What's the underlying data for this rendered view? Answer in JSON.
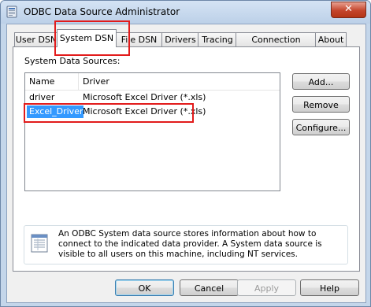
{
  "window": {
    "title": "ODBC Data Source Administrator",
    "close_glyph": "✕",
    "icon": "odbc-admin-icon"
  },
  "tabs": [
    {
      "label": "User DSN",
      "active": false
    },
    {
      "label": "System DSN",
      "active": true
    },
    {
      "label": "File DSN",
      "active": false
    },
    {
      "label": "Drivers",
      "active": false
    },
    {
      "label": "Tracing",
      "active": false
    },
    {
      "label": "Connection Pooling",
      "active": false
    },
    {
      "label": "About",
      "active": false
    }
  ],
  "panel": {
    "group_label": "System Data Sources:",
    "columns": [
      "Name",
      "Driver"
    ],
    "rows": [
      {
        "name": "driver",
        "driver": "Microsoft Excel Driver (*.xls)",
        "selected": false
      },
      {
        "name": "Excel_Driver",
        "driver": "Microsoft Excel Driver (*.xls)",
        "selected": true
      }
    ],
    "buttons": {
      "add": "Add...",
      "remove": "Remove",
      "configure": "Configure..."
    },
    "info": {
      "icon": "data-source-info-icon",
      "text": "An ODBC System data source stores information about how to connect to the indicated data provider.   A System data source is visible to all users on this machine, including NT services."
    }
  },
  "footer": {
    "ok": "OK",
    "cancel": "Cancel",
    "apply": "Apply",
    "help": "Help"
  },
  "colors": {
    "selection": "#3399ff",
    "annotation": "#e21b1b",
    "title_bar": "#bcd0e8"
  }
}
